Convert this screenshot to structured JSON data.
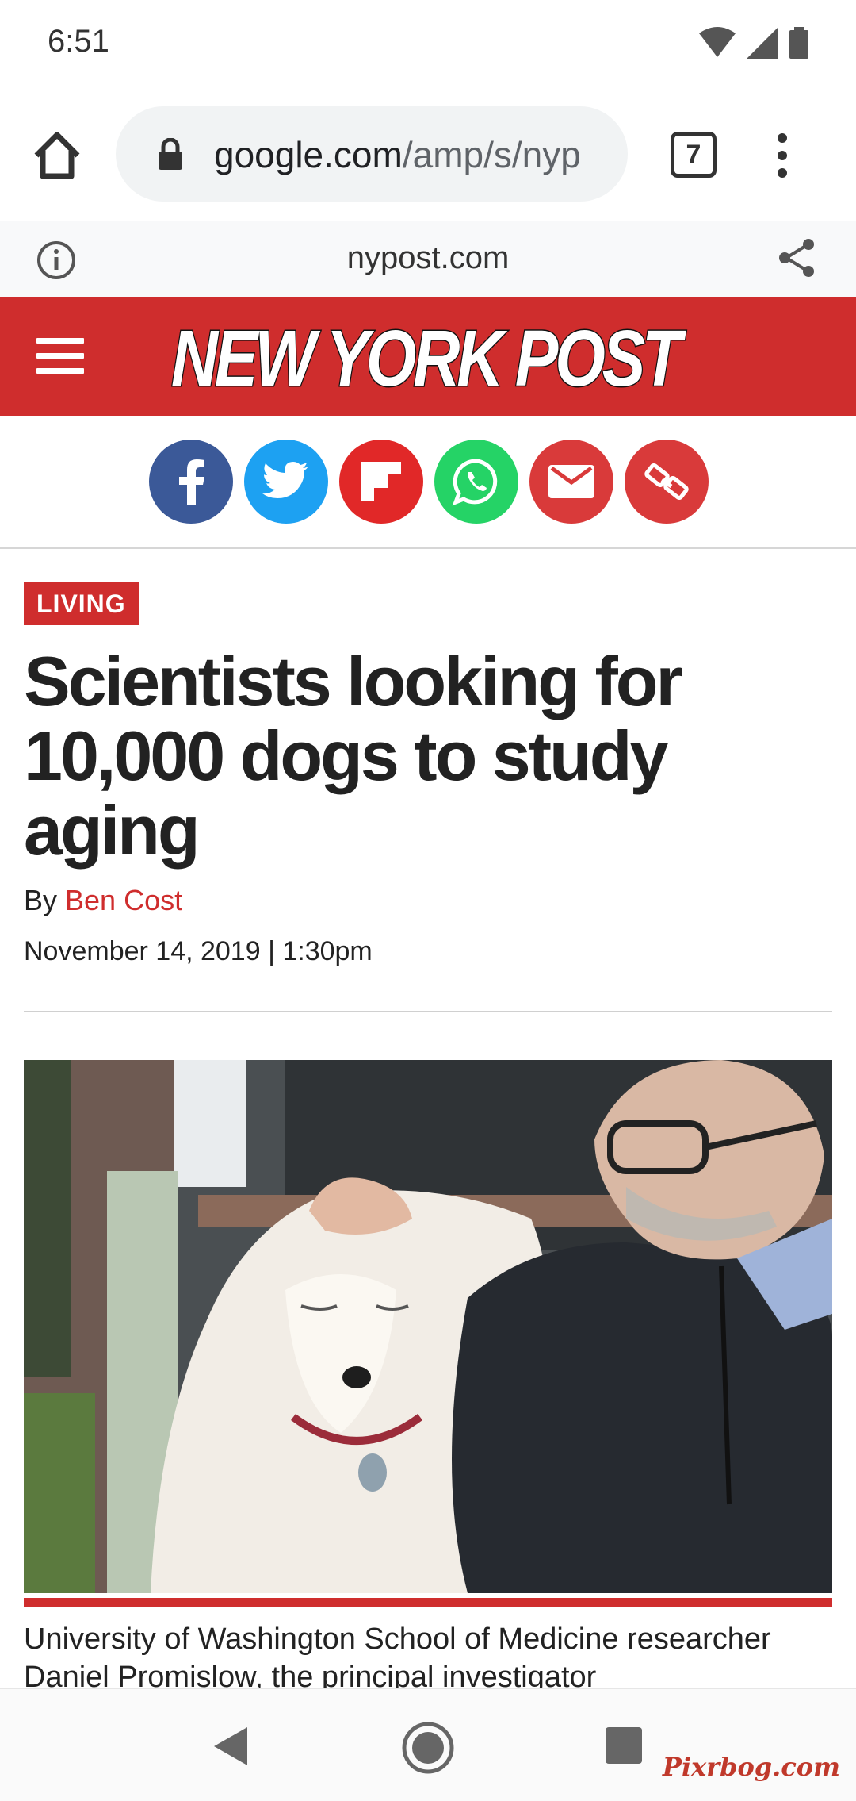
{
  "status_bar": {
    "time": "6:51"
  },
  "toolbar": {
    "url_domain": "google.com",
    "url_path": "/amp/s/nyp",
    "tab_count": "7"
  },
  "amp_bar": {
    "domain": "nypost.com"
  },
  "header": {
    "logo_text": "NEW YORK POST"
  },
  "share_buttons": [
    {
      "name": "facebook",
      "color": "#3b5998"
    },
    {
      "name": "twitter",
      "color": "#1da1f2"
    },
    {
      "name": "flipboard",
      "color": "#e12828"
    },
    {
      "name": "whatsapp",
      "color": "#25d366"
    },
    {
      "name": "email",
      "color": "#d93a3a"
    },
    {
      "name": "copy-link",
      "color": "#d93a3a"
    }
  ],
  "article": {
    "section": "LIVING",
    "headline": "Scientists looking for 10,000 dogs to study aging",
    "byline_prefix": "By ",
    "author": "Ben Cost",
    "dateline": "November 14, 2019 | 1:30pm",
    "caption": "University of Washington School of Medicine researcher Daniel Promislow, the principal investigator"
  },
  "watermark": "Pixrbog.com",
  "colors": {
    "brand_red": "#cf2d2d",
    "text": "#222222"
  }
}
